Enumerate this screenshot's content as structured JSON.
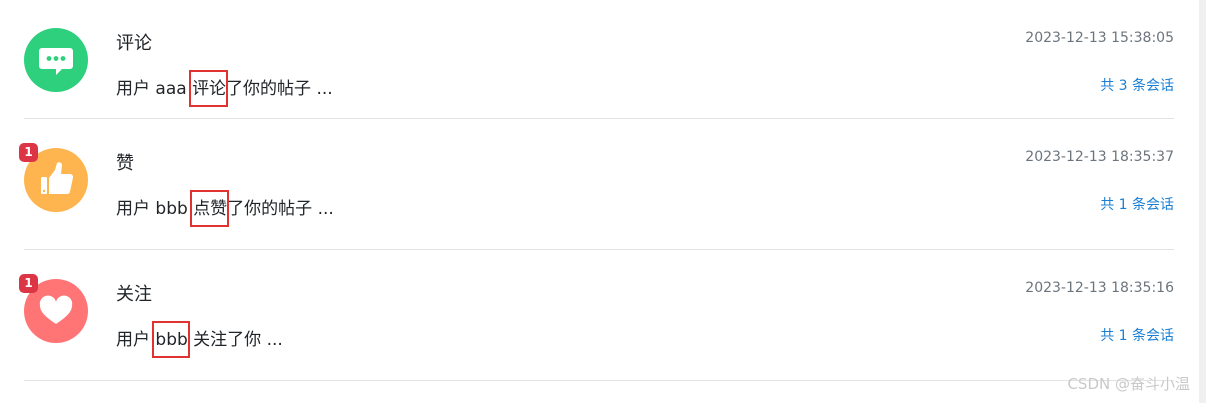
{
  "items": [
    {
      "title": "评论",
      "time": "2023-12-13 15:38:05",
      "msg_prefix": "用户 aaa ",
      "msg_highlight": "评论",
      "msg_suffix": "了你的帖子 ...",
      "link": "共 3 条会话",
      "badge": "",
      "icon": "chat-bubble-icon",
      "color": "#2ed07e"
    },
    {
      "title": "赞",
      "time": "2023-12-13 18:35:37",
      "msg_prefix": "用户 bbb ",
      "msg_highlight": "点赞",
      "msg_suffix": "了你的帖子 ...",
      "link": "共 1 条会话",
      "badge": "1",
      "icon": "thumbs-up-icon",
      "color": "#ffb54f"
    },
    {
      "title": "关注",
      "time": "2023-12-13 18:35:16",
      "msg_prefix": "用户 ",
      "msg_highlight": "bbb",
      "msg_suffix": " 关注了你 ...",
      "link": "共 1 条会话",
      "badge": "1",
      "icon": "heart-icon",
      "color": "#ff7575"
    }
  ],
  "watermark": "CSDN @奋斗小温"
}
